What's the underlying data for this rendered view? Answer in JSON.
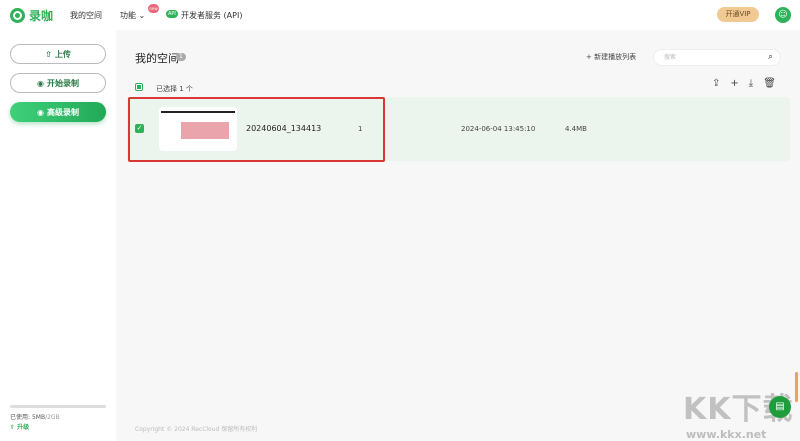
{
  "header": {
    "logo": "录咖",
    "nav": [
      "我的空间",
      "功能",
      "开发者服务 (API)"
    ],
    "new_badge": "new",
    "api_badge": "API",
    "vip": "开通VIP",
    "avatar_icon": "user-icon"
  },
  "sidebar": {
    "upload": "上传",
    "start_record": "开始录制",
    "advanced_record": "高级录制",
    "usage_label": "已使用:",
    "usage_used": "5MB",
    "usage_total": "/2GB",
    "usage_fraction": 0.0025,
    "upgrade": "升级"
  },
  "main": {
    "title": "我的空间",
    "count": "1",
    "new_playlist": "新建播放列表",
    "search_placeholder": "搜索",
    "selected_text": "已选择 1 个",
    "files": [
      {
        "name": "20240604_134413",
        "count": "1",
        "date": "2024-06-04 13:45:10",
        "size": "4.4MB",
        "checked": true
      }
    ],
    "copyright": "Copyright © 2024 RecCloud 保留所有权利"
  },
  "watermark": {
    "logo": "KK下载",
    "url": "www.kkx.net"
  }
}
